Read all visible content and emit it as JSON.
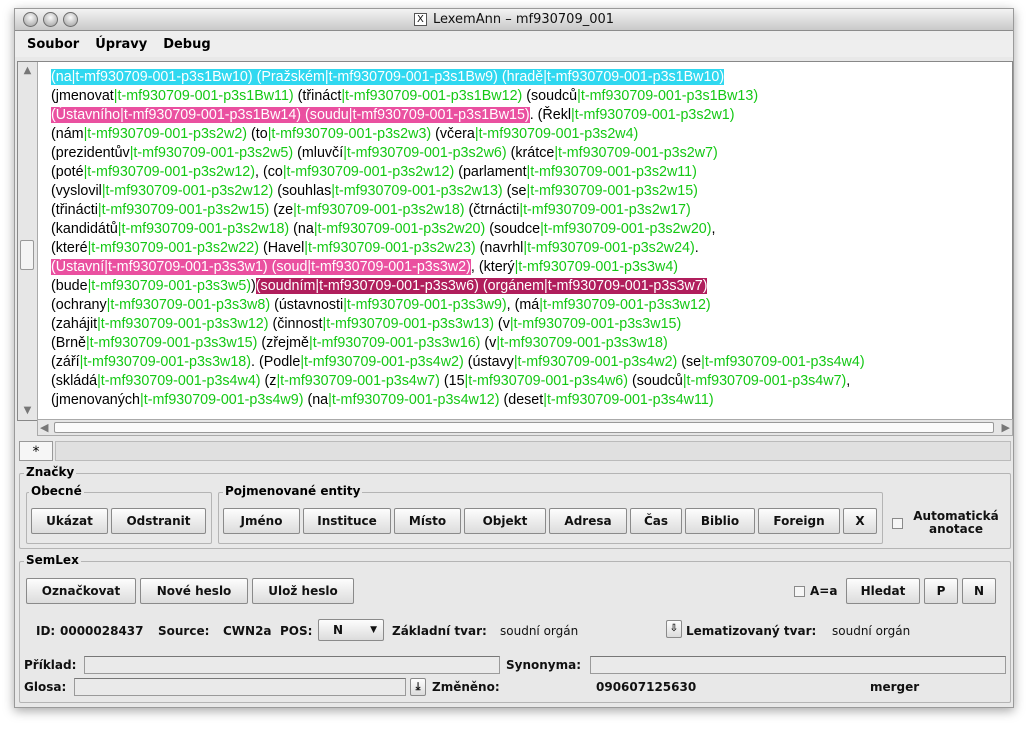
{
  "window": {
    "title": "LexemAnn – mf930709_001",
    "icon": "x11-icon"
  },
  "menu": [
    "Soubor",
    "Úpravy",
    "Debug"
  ],
  "text_lines": [
    [
      [
        "(na",
        "cy"
      ],
      [
        "|t-mf930709-001-p3s1Bw10) (Pražském",
        "cy"
      ],
      [
        "|t-mf930709-001-p3s1Bw9) (hradě",
        "cy"
      ],
      [
        "|t-mf930709-001-p3s1Bw10)",
        "cy"
      ]
    ],
    [
      [
        "(",
        ""
      ],
      [
        "jmenovat",
        ""
      ],
      [
        "|t-mf930709-001-p3s1Bw11)",
        "g"
      ],
      [
        " (",
        ""
      ],
      [
        "třináct",
        ""
      ],
      [
        "|t-mf930709-001-p3s1Bw12)",
        "g"
      ],
      [
        " (",
        ""
      ],
      [
        "soudců",
        ""
      ],
      [
        "|t-mf930709-001-p3s1Bw13)",
        "g"
      ]
    ],
    [
      [
        "(Ústavního|t-mf930709-001-p3s1Bw14) (soudu|t-mf930709-001-p3s1Bw15)",
        "pk"
      ],
      [
        ". (",
        ""
      ],
      [
        "Řekl",
        ""
      ],
      [
        "|t-mf930709-001-p3s2w1)",
        "g"
      ]
    ],
    [
      [
        "(",
        ""
      ],
      [
        "nám",
        ""
      ],
      [
        "|t-mf930709-001-p3s2w2)",
        "g"
      ],
      [
        " (",
        ""
      ],
      [
        "to",
        ""
      ],
      [
        "|t-mf930709-001-p3s2w3)",
        "g"
      ],
      [
        " (",
        ""
      ],
      [
        "včera",
        ""
      ],
      [
        "|t-mf930709-001-p3s2w4)",
        "g"
      ]
    ],
    [
      [
        "(",
        ""
      ],
      [
        "prezidentův",
        ""
      ],
      [
        "|t-mf930709-001-p3s2w5)",
        "g"
      ],
      [
        " (",
        ""
      ],
      [
        "mluvčí",
        ""
      ],
      [
        "|t-mf930709-001-p3s2w6)",
        "g"
      ],
      [
        " (",
        ""
      ],
      [
        "krátce",
        ""
      ],
      [
        "|t-mf930709-001-p3s2w7)",
        "g"
      ]
    ],
    [
      [
        "(",
        ""
      ],
      [
        "poté",
        ""
      ],
      [
        "|t-mf930709-001-p3s2w12)",
        "g"
      ],
      [
        ", (",
        ""
      ],
      [
        "co",
        ""
      ],
      [
        "|t-mf930709-001-p3s2w12)",
        "g"
      ],
      [
        " (",
        ""
      ],
      [
        "parlament",
        ""
      ],
      [
        "|t-mf930709-001-p3s2w11)",
        "g"
      ]
    ],
    [
      [
        "(",
        ""
      ],
      [
        "vyslovil",
        ""
      ],
      [
        "|t-mf930709-001-p3s2w12)",
        "g"
      ],
      [
        " (",
        ""
      ],
      [
        "souhlas",
        ""
      ],
      [
        "|t-mf930709-001-p3s2w13)",
        "g"
      ],
      [
        " (",
        ""
      ],
      [
        "se",
        ""
      ],
      [
        "|t-mf930709-001-p3s2w15)",
        "g"
      ]
    ],
    [
      [
        "(",
        ""
      ],
      [
        "třinácti",
        ""
      ],
      [
        "|t-mf930709-001-p3s2w15)",
        "g"
      ],
      [
        " (",
        ""
      ],
      [
        "ze",
        ""
      ],
      [
        "|t-mf930709-001-p3s2w18)",
        "g"
      ],
      [
        " (",
        ""
      ],
      [
        "čtrnácti",
        ""
      ],
      [
        "|t-mf930709-001-p3s2w17)",
        "g"
      ]
    ],
    [
      [
        "(",
        ""
      ],
      [
        "kandidátů",
        ""
      ],
      [
        "|t-mf930709-001-p3s2w18)",
        "g"
      ],
      [
        " (",
        ""
      ],
      [
        "na",
        ""
      ],
      [
        "|t-mf930709-001-p3s2w20)",
        "g"
      ],
      [
        " (",
        ""
      ],
      [
        "soudce",
        ""
      ],
      [
        "|t-mf930709-001-p3s2w20)",
        "g"
      ],
      [
        ",",
        ""
      ]
    ],
    [
      [
        "(",
        ""
      ],
      [
        "které",
        ""
      ],
      [
        "|t-mf930709-001-p3s2w22)",
        "g"
      ],
      [
        " (",
        ""
      ],
      [
        "Havel",
        ""
      ],
      [
        "|t-mf930709-001-p3s2w23)",
        "g"
      ],
      [
        " (",
        ""
      ],
      [
        "navrhl",
        ""
      ],
      [
        "|t-mf930709-001-p3s2w24)",
        "g"
      ],
      [
        ".",
        ""
      ]
    ],
    [
      [
        "(Ústavní|t-mf930709-001-p3s3w1) (soud|t-mf930709-001-p3s3w2)",
        "pk"
      ],
      [
        ", (",
        ""
      ],
      [
        "který",
        ""
      ],
      [
        "|t-mf930709-001-p3s3w4)",
        "g"
      ]
    ],
    [
      [
        "(",
        ""
      ],
      [
        "bude",
        ""
      ],
      [
        "|t-mf930709-001-p3s3w5)",
        "g"
      ],
      [
        ")",
        ""
      ],
      [
        "(soudním|t-mf930709-001-p3s3w6) (orgánem|t-mf930709-001-p3s3w7)",
        "mg"
      ]
    ],
    [
      [
        "(",
        ""
      ],
      [
        "ochrany",
        ""
      ],
      [
        "|t-mf930709-001-p3s3w8)",
        "g"
      ],
      [
        " (",
        ""
      ],
      [
        "ústavnosti",
        ""
      ],
      [
        "|t-mf930709-001-p3s3w9)",
        "g"
      ],
      [
        ", (",
        ""
      ],
      [
        "má",
        ""
      ],
      [
        "|t-mf930709-001-p3s3w12)",
        "g"
      ]
    ],
    [
      [
        "(",
        ""
      ],
      [
        "zahájit",
        ""
      ],
      [
        "|t-mf930709-001-p3s3w12)",
        "g"
      ],
      [
        " (",
        ""
      ],
      [
        "činnost",
        ""
      ],
      [
        "|t-mf930709-001-p3s3w13)",
        "g"
      ],
      [
        " (",
        ""
      ],
      [
        "v",
        ""
      ],
      [
        "|t-mf930709-001-p3s3w15)",
        "g"
      ]
    ],
    [
      [
        "(",
        ""
      ],
      [
        "Brně",
        ""
      ],
      [
        "|t-mf930709-001-p3s3w15)",
        "g"
      ],
      [
        " (",
        ""
      ],
      [
        "zřejmě",
        ""
      ],
      [
        "|t-mf930709-001-p3s3w16)",
        "g"
      ],
      [
        " (",
        ""
      ],
      [
        "v",
        ""
      ],
      [
        "|t-mf930709-001-p3s3w18)",
        "g"
      ]
    ],
    [
      [
        "(",
        ""
      ],
      [
        "září",
        ""
      ],
      [
        "|t-mf930709-001-p3s3w18)",
        "g"
      ],
      [
        ". (",
        ""
      ],
      [
        "Podle",
        ""
      ],
      [
        "|t-mf930709-001-p3s4w2)",
        "g"
      ],
      [
        " (",
        ""
      ],
      [
        "ústavy",
        ""
      ],
      [
        "|t-mf930709-001-p3s4w2)",
        "g"
      ],
      [
        " (",
        ""
      ],
      [
        "se",
        ""
      ],
      [
        "|t-mf930709-001-p3s4w4)",
        "g"
      ]
    ],
    [
      [
        "(",
        ""
      ],
      [
        "skládá",
        ""
      ],
      [
        "|t-mf930709-001-p3s4w4)",
        "g"
      ],
      [
        " (",
        ""
      ],
      [
        "z",
        ""
      ],
      [
        "|t-mf930709-001-p3s4w7)",
        "g"
      ],
      [
        " (",
        ""
      ],
      [
        "15",
        ""
      ],
      [
        "|t-mf930709-001-p3s4w6)",
        "g"
      ],
      [
        " (",
        ""
      ],
      [
        "soudců",
        ""
      ],
      [
        "|t-mf930709-001-p3s4w7)",
        "g"
      ],
      [
        ",",
        ""
      ]
    ],
    [
      [
        "(",
        ""
      ],
      [
        "jmenovaných",
        ""
      ],
      [
        "|t-mf930709-001-p3s4w9)",
        "g"
      ],
      [
        " (",
        ""
      ],
      [
        "na",
        ""
      ],
      [
        "|t-mf930709-001-p3s4w12)",
        "g"
      ],
      [
        " (",
        ""
      ],
      [
        "deset",
        ""
      ],
      [
        "|t-mf930709-001-p3s4w11)",
        "g"
      ]
    ]
  ],
  "tab_label": "*",
  "znacky": {
    "legend": "Značky",
    "obecne": {
      "legend": "Obecné",
      "ukazat": "Ukázat",
      "odstranit": "Odstranit"
    },
    "entity": {
      "legend": "Pojmenované entity",
      "buttons": [
        "Jméno",
        "Instituce",
        "Místo",
        "Objekt",
        "Adresa",
        "Čas",
        "Biblio",
        "Foreign",
        "X"
      ]
    },
    "auto_label": "Automatická anotace"
  },
  "semlex": {
    "legend": "SemLex",
    "oznackovat": "Označkovat",
    "nove_heslo": "Nové heslo",
    "uloz_heslo": "Ulož heslo",
    "aa_label": "A=a",
    "hledat": "Hledat",
    "p": "P",
    "n": "N",
    "id_label": "ID:",
    "id_value": "0000028437",
    "source_label": "Source:",
    "source_value": "CWN2a",
    "pos_label": "POS:",
    "pos_value": "N",
    "zakladni_label": "Základní tvar:",
    "zakladni_value": "soudní orgán",
    "lemma_label": "Lematizovaný tvar:",
    "lemma_value": "soudní orgán",
    "priklad_label": "Příklad:",
    "synonyma_label": "Synonyma:",
    "glosa_label": "Glosa:",
    "zmeneno_label": "Změněno:",
    "zmeneno_value": "090607125630",
    "user": "merger"
  },
  "colors": {
    "tag": "#14c814",
    "cyan": "#30d8f0",
    "pink": "#ea50a0",
    "magenta": "#b01e5c"
  }
}
